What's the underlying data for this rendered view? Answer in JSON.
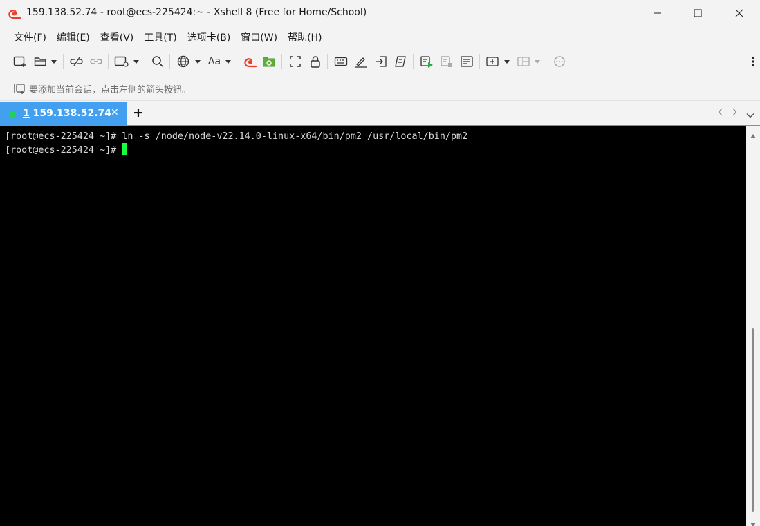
{
  "window": {
    "title": "159.138.52.74 - root@ecs-225424:~ - Xshell 8 (Free for Home/School)",
    "app_icon": "xshell-snail-icon",
    "accent_color": "#e8402c"
  },
  "menu": {
    "items": [
      "文件(F)",
      "编辑(E)",
      "查看(V)",
      "工具(T)",
      "选项卡(B)",
      "窗口(W)",
      "帮助(H)"
    ]
  },
  "toolbar": {
    "font_label": "Aa",
    "icons": [
      "new-session-icon",
      "open-folder-icon",
      "disconnect-icon",
      "reconnect-icon",
      "new-window-icon",
      "search-icon",
      "globe-icon",
      "font-icon",
      "xshell-icon",
      "xftp-icon",
      "fullscreen-icon",
      "lock-icon",
      "keyboard-icon",
      "highlight-icon",
      "send-icon",
      "script-icon",
      "log-start-icon",
      "log-stop-icon",
      "compose-icon",
      "new-tab-group-icon",
      "layout-icon",
      "chat-icon",
      "more-icon"
    ]
  },
  "session_bar": {
    "hint": "要添加当前会话，点击左侧的箭头按钮。"
  },
  "tabs": {
    "active": {
      "number": "1",
      "label": "159.138.52.74",
      "status_color": "#1ed35a",
      "close": "✕"
    },
    "add": "+",
    "nav_prev": "‹",
    "nav_next": "›",
    "menu": "⌄",
    "accent_color": "#43a0f0"
  },
  "terminal": {
    "lines": [
      "[root@ecs-225424 ~]# ln -s /node/node-v22.14.0-linux-x64/bin/pm2 /usr/local/bin/pm2",
      "[root@ecs-225424 ~]# "
    ],
    "cursor_color": "#18ff3c",
    "background": "#000000",
    "foreground": "#d8d8d8"
  }
}
